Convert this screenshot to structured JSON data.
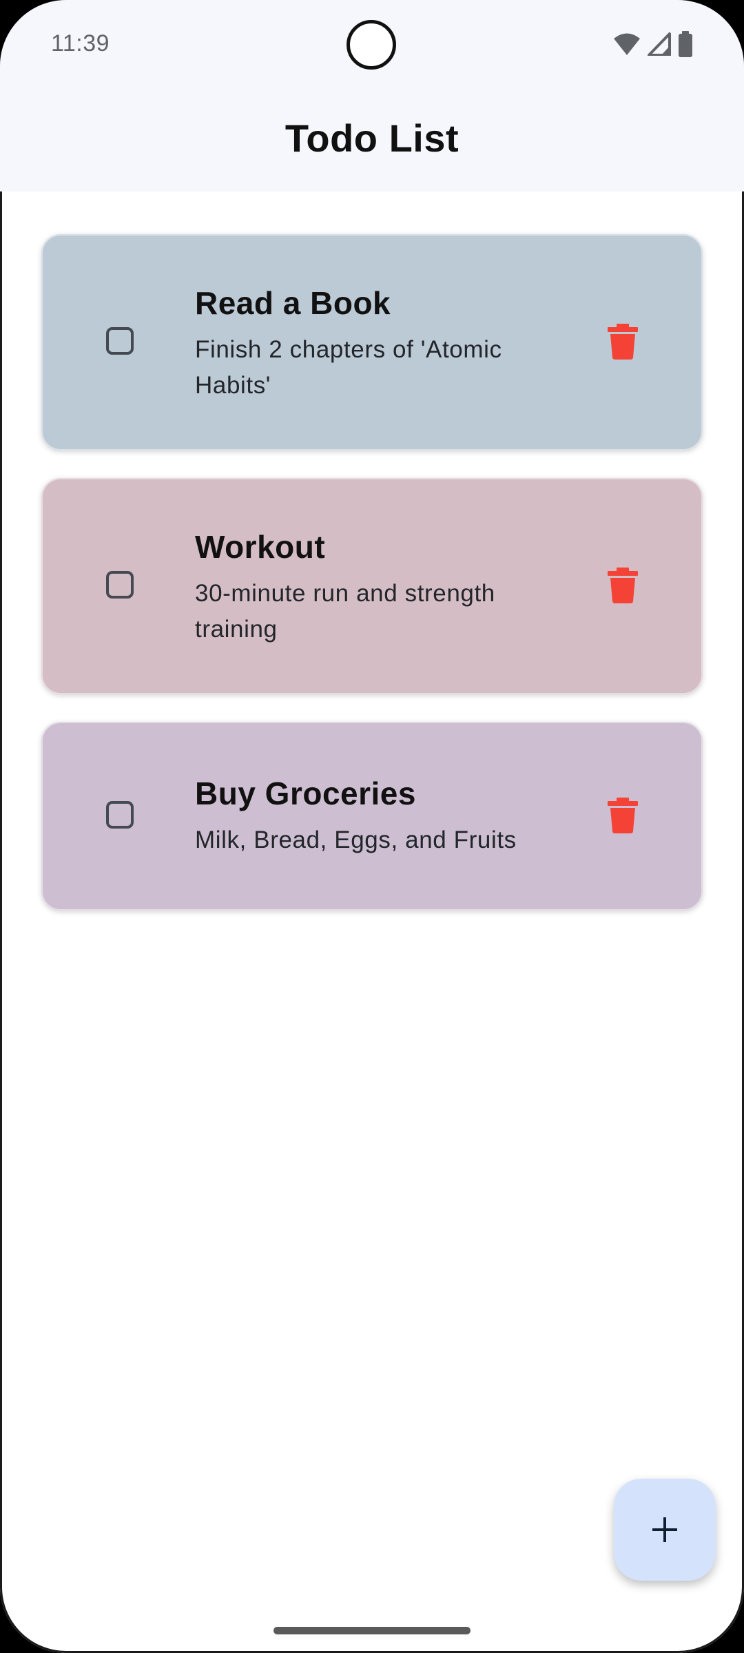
{
  "status_bar": {
    "time": "11:39",
    "icons": [
      "wifi-icon",
      "cellular-signal-icon",
      "battery-icon"
    ]
  },
  "app_bar": {
    "title": "Todo List"
  },
  "todos": [
    {
      "title": "Read a Book",
      "description": "Finish 2 chapters of 'Atomic Habits'",
      "checked": false,
      "color": "#bccad6"
    },
    {
      "title": "Workout",
      "description": "30-minute run and strength training",
      "checked": false,
      "color": "#d5bdc5"
    },
    {
      "title": "Buy Groceries",
      "description": "Milk, Bread, Eggs, and Fruits",
      "checked": false,
      "color": "#cdbfd1"
    }
  ],
  "actions": {
    "delete_icon": "trash-icon",
    "delete_color": "#f44336",
    "fab_icon": "plus-icon",
    "fab_color": "#d4e3fb"
  }
}
